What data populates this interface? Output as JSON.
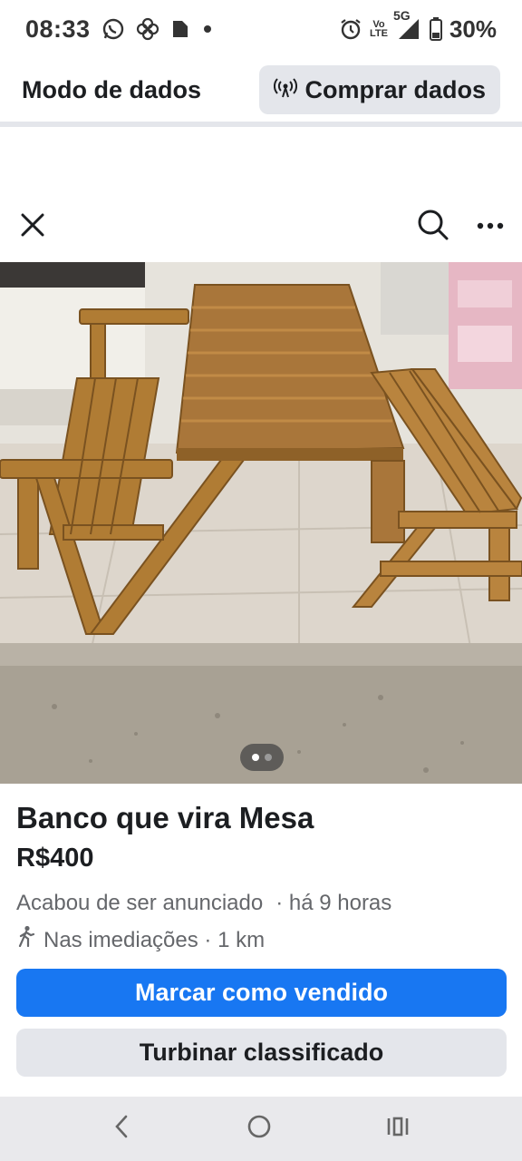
{
  "status_bar": {
    "time": "08:33",
    "left_icons": [
      "whatsapp-icon",
      "pinwheel-icon",
      "notification-icon",
      "dot-icon"
    ],
    "right_icons": [
      "alarm-icon",
      "volte-icon",
      "5g-signal-icon",
      "battery-icon"
    ],
    "volte_top": "Vo",
    "volte_bottom": "LTE",
    "network": "5G",
    "battery": "30%"
  },
  "data_banner": {
    "title": "Modo de dados",
    "buy_button_label": "Comprar dados",
    "buy_button_icon": "broadcast-icon"
  },
  "listing_nav": {
    "close_icon": "close-icon",
    "search_icon": "search-icon",
    "more_icon": "more-icon"
  },
  "photo": {
    "description_icon": "wooden-bench-table-photo",
    "page_count": 2,
    "current_page": 1
  },
  "listing": {
    "title": "Banco que vira Mesa",
    "price": "R$400",
    "posted_status": "Acabou de ser anunciado",
    "posted_time": "· há 9 horas",
    "location": "Nas imediações · 1 km"
  },
  "actions": {
    "mark_sold": "Marcar como vendido",
    "boost": "Turbinar classificado"
  },
  "colors": {
    "primary": "#1877f2",
    "secondary_button": "#e4e6eb",
    "meta_text": "#65676b"
  },
  "android_nav": [
    "back-icon",
    "home-icon",
    "recents-icon"
  ]
}
